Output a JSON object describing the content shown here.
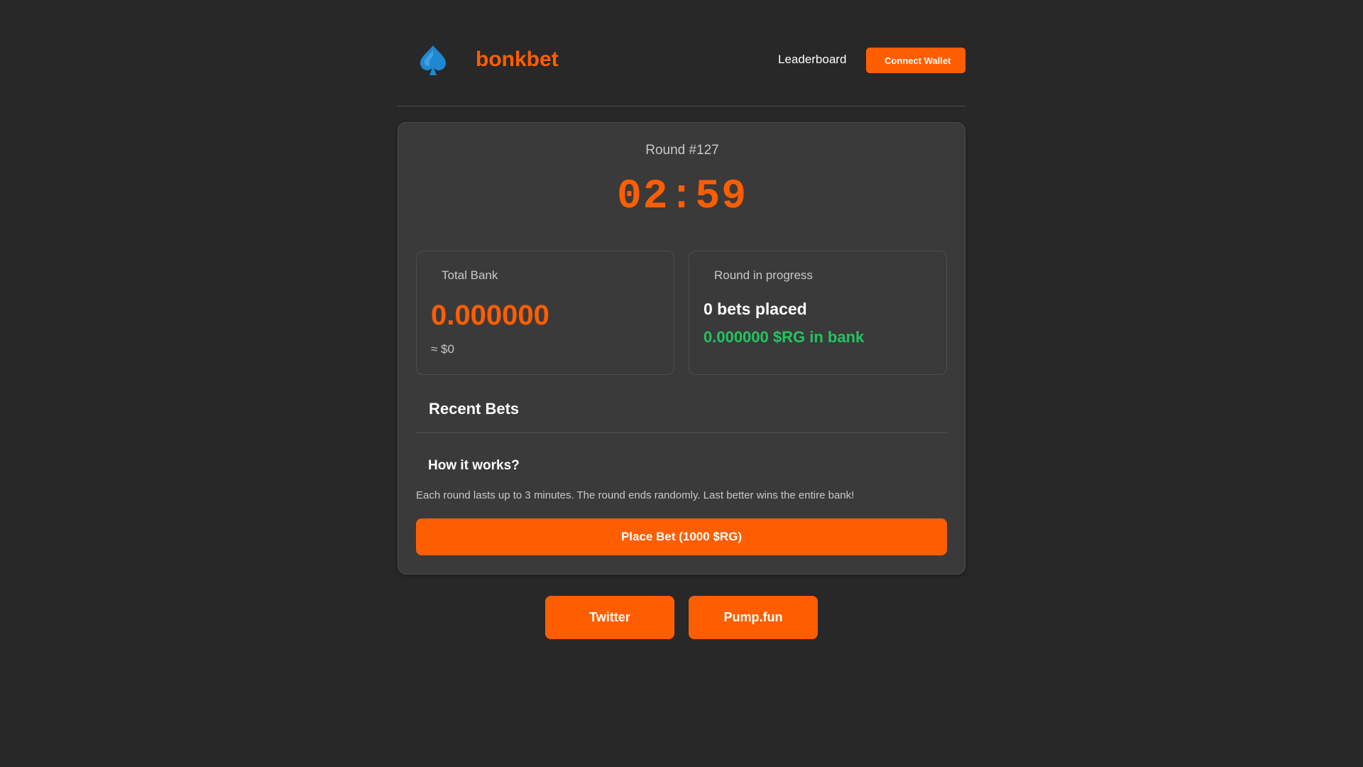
{
  "header": {
    "brand": "bonkbet",
    "nav_leaderboard": "Leaderboard",
    "connect_wallet": "Connect Wallet",
    "logo_icon": "spade-icon"
  },
  "round": {
    "label": "Round #127",
    "timer": "02:59"
  },
  "total_bank": {
    "title": "Total Bank",
    "value": "0.000000",
    "usd": "≈ $0"
  },
  "round_status": {
    "title": "Round in progress",
    "bets_placed": "0 bets placed",
    "bank_text": "0.000000 $RG in bank"
  },
  "recent_bets": {
    "title": "Recent Bets"
  },
  "how_it_works": {
    "title": "How it works?",
    "text": "Each round lasts up to 3 minutes. The round ends randomly. Last better wins the entire bank!"
  },
  "place_bet_label": "Place Bet (1000 $RG)",
  "footer": {
    "twitter": "Twitter",
    "pumpfun": "Pump.fun"
  },
  "colors": {
    "background": "#282828",
    "card": "#3a3a3a",
    "accent": "#ff5e00",
    "green": "#22c55e",
    "logo_blue": "#1e88d2"
  }
}
